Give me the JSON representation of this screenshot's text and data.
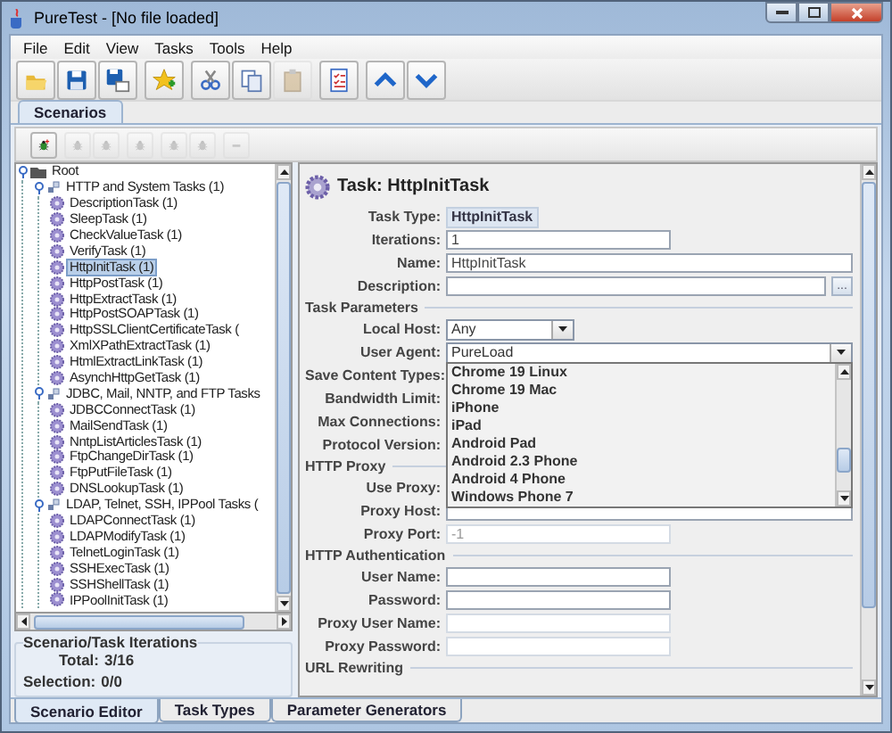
{
  "window": {
    "title": "PureTest - [No file loaded]"
  },
  "menu": [
    "File",
    "Edit",
    "View",
    "Tasks",
    "Tools",
    "Help"
  ],
  "toolbar_groups": [
    {
      "buttons": [
        {
          "disabled": false
        },
        {
          "disabled": false
        },
        {
          "disabled": false
        }
      ]
    },
    {
      "buttons": [
        {
          "disabled": false
        }
      ]
    },
    {
      "buttons": [
        {
          "disabled": false
        },
        {
          "disabled": false
        },
        {
          "disabled": true
        }
      ]
    },
    {
      "buttons": [
        {
          "disabled": false
        }
      ]
    },
    {
      "buttons": [
        {
          "disabled": false
        },
        {
          "disabled": false
        }
      ]
    }
  ],
  "tabs": [
    {
      "label": "Scenarios",
      "selected": true
    }
  ],
  "scenario_toolbar_groups": [
    {
      "buttons": [
        {
          "disabled": false
        }
      ]
    },
    {
      "buttons": [
        {
          "disabled": true
        },
        {
          "disabled": true
        }
      ]
    },
    {
      "buttons": [
        {
          "disabled": true
        }
      ]
    },
    {
      "buttons": [
        {
          "disabled": true
        },
        {
          "disabled": true
        }
      ]
    },
    {
      "buttons": [
        {
          "disabled": true
        }
      ]
    }
  ],
  "tree": {
    "label": "Root",
    "selected": false,
    "expanded": true,
    "children": [
      {
        "label": "HTTP and System Tasks (1)",
        "selected": false,
        "expanded": true,
        "children": [
          {
            "label": "DescriptionTask (1)",
            "selected": false
          },
          {
            "label": "SleepTask (1)",
            "selected": false
          },
          {
            "label": "CheckValueTask (1)",
            "selected": false
          },
          {
            "label": "VerifyTask (1)",
            "selected": false
          },
          {
            "label": "HttpInitTask (1)",
            "selected": true
          },
          {
            "label": "HttpPostTask (1)",
            "selected": false
          },
          {
            "label": "HttpExtractTask (1)",
            "selected": false
          },
          {
            "label": "HttpPostSOAPTask (1)",
            "selected": false
          },
          {
            "label": "HttpSSLClientCertificateTask (",
            "selected": false
          },
          {
            "label": "XmlXPathExtractTask (1)",
            "selected": false
          },
          {
            "label": "HtmlExtractLinkTask (1)",
            "selected": false
          },
          {
            "label": "AsynchHttpGetTask (1)",
            "selected": false
          }
        ]
      },
      {
        "label": "JDBC, Mail, NNTP, and FTP Tasks",
        "selected": false,
        "expanded": true,
        "children": [
          {
            "label": "JDBCConnectTask (1)",
            "selected": false
          },
          {
            "label": "MailSendTask (1)",
            "selected": false
          },
          {
            "label": "NntpListArticlesTask (1)",
            "selected": false
          },
          {
            "label": "FtpChangeDirTask (1)",
            "selected": false
          },
          {
            "label": "FtpPutFileTask (1)",
            "selected": false
          },
          {
            "label": "DNSLookupTask (1)",
            "selected": false
          }
        ]
      },
      {
        "label": "LDAP, Telnet, SSH, IPPool Tasks (",
        "selected": false,
        "expanded": true,
        "children": [
          {
            "label": "LDAPConnectTask (1)",
            "selected": false
          },
          {
            "label": "LDAPModifyTask (1)",
            "selected": false
          },
          {
            "label": "TelnetLoginTask (1)",
            "selected": false
          },
          {
            "label": "SSHExecTask (1)",
            "selected": false
          },
          {
            "label": "SSHShellTask (1)",
            "selected": false
          },
          {
            "label": "IPPoolInitTask (1)",
            "selected": false
          }
        ]
      }
    ]
  },
  "iterations": {
    "title": "Scenario/Task Iterations",
    "total_label": "Total:",
    "total": "3/16",
    "selection_label": "Selection:",
    "selection": "0/0"
  },
  "task": {
    "title": "Task: HttpInitTask",
    "fields": [
      {
        "kind": "readonly",
        "label": "Task Type:",
        "value": "HttpInitTask"
      },
      {
        "kind": "field",
        "label": "Iterations:",
        "value": "1",
        "disabled": false
      },
      {
        "kind": "wide-field",
        "label": "Name:",
        "value": "HttpInitTask",
        "disabled": false
      },
      {
        "kind": "browse-field",
        "label": "Description:",
        "button": "..."
      },
      {
        "kind": "section",
        "label": "Task Parameters"
      },
      {
        "kind": "combo",
        "label": "Local Host:",
        "value": "Any"
      },
      {
        "kind": "editable-combo",
        "label": "User Agent:",
        "value": "PureLoad",
        "expanded": true,
        "options": [
          "Chrome 19 Linux",
          "Chrome 19 Mac",
          "iPhone",
          "iPad",
          "Android Pad",
          "Android 2.3 Phone",
          "Android 4 Phone",
          "Windows Phone 7"
        ]
      },
      {
        "kind": "covered",
        "label": "Save Content Types:"
      },
      {
        "kind": "covered",
        "label": "Bandwidth Limit:"
      },
      {
        "kind": "covered",
        "label": "Max Connections:"
      },
      {
        "kind": "covered",
        "label": "Protocol Version:"
      },
      {
        "kind": "section",
        "label": "HTTP Proxy"
      },
      {
        "kind": "covered",
        "label": "Use Proxy:"
      },
      {
        "kind": "wide-field",
        "label": "Proxy Host:",
        "disabled": false
      },
      {
        "kind": "field",
        "label": "Proxy Port:",
        "value": "-1",
        "disabled": true
      },
      {
        "kind": "section",
        "label": "HTTP Authentication"
      },
      {
        "kind": "field",
        "label": "User Name:",
        "disabled": false
      },
      {
        "kind": "field",
        "label": "Password:",
        "disabled": false
      },
      {
        "kind": "field",
        "label": "Proxy User Name:",
        "disabled": true
      },
      {
        "kind": "field",
        "label": "Proxy Password:",
        "disabled": true
      },
      {
        "kind": "section",
        "label": "URL Rewriting"
      }
    ]
  },
  "bottom_tabs": [
    {
      "label": "Scenario Editor",
      "selected": true
    },
    {
      "label": "Task Types",
      "selected": false
    },
    {
      "label": "Parameter Generators",
      "selected": false
    }
  ]
}
